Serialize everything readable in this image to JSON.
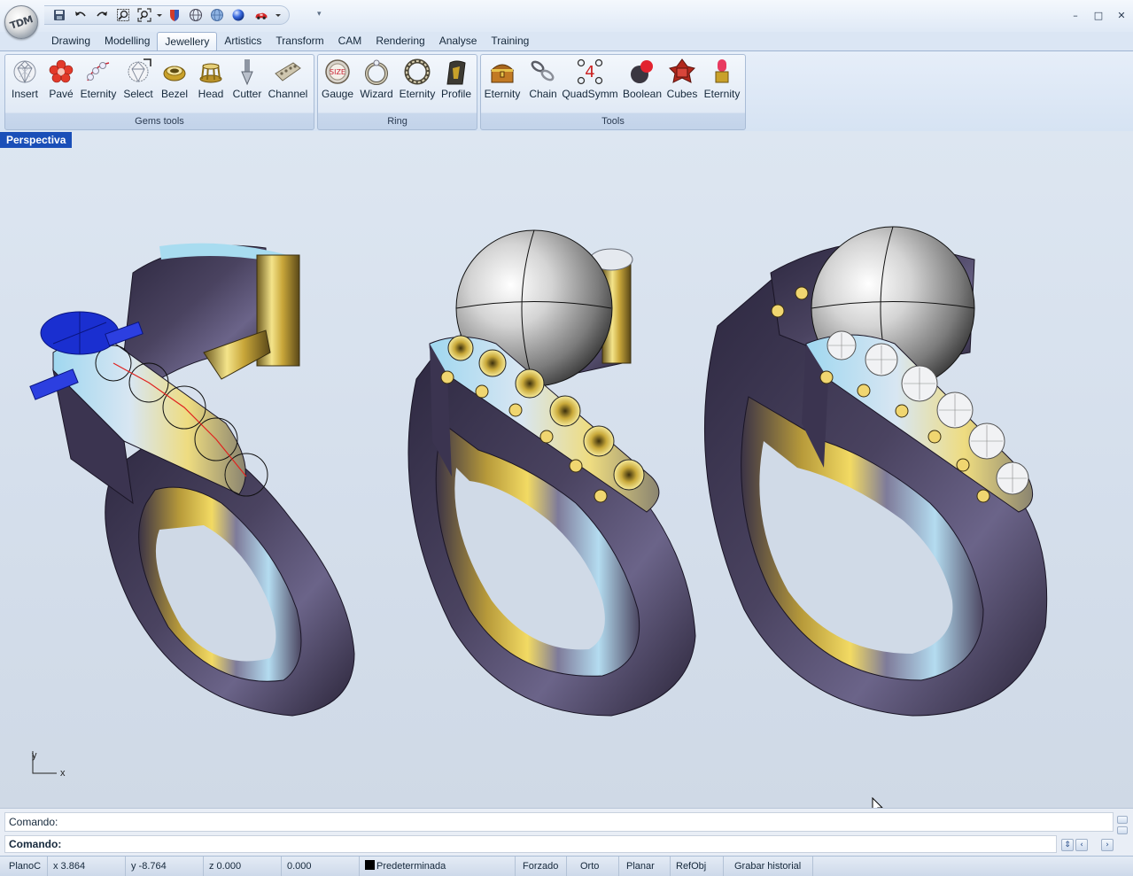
{
  "app": {
    "logo_text": "TDM"
  },
  "quick_access": {
    "icons": [
      "save-icon",
      "undo-icon",
      "redo-icon",
      "zoom-window-icon",
      "zoom-extents-icon",
      "shield-icon",
      "wireframe-sphere-icon",
      "shaded-sphere-icon",
      "rendered-sphere-icon",
      "car-render-icon"
    ]
  },
  "window_controls": {
    "minimize": "–",
    "maximize": "□",
    "close": "✕"
  },
  "tabs": [
    {
      "label": "Drawing"
    },
    {
      "label": "Modelling"
    },
    {
      "label": "Jewellery",
      "active": true
    },
    {
      "label": "Artistics"
    },
    {
      "label": "Transform"
    },
    {
      "label": "CAM"
    },
    {
      "label": "Rendering"
    },
    {
      "label": "Analyse"
    },
    {
      "label": "Training"
    }
  ],
  "ribbon": {
    "groups": [
      {
        "label": "Gems tools",
        "buttons": [
          {
            "label": "Insert",
            "icon": "diamond-icon"
          },
          {
            "label": "Pavé",
            "icon": "flower-gems-icon"
          },
          {
            "label": "Eternity",
            "icon": "gem-chain-icon"
          },
          {
            "label": "Select",
            "icon": "select-gem-icon"
          },
          {
            "label": "Bezel",
            "icon": "bezel-icon"
          },
          {
            "label": "Head",
            "icon": "head-icon"
          },
          {
            "label": "Cutter",
            "icon": "cutter-icon"
          },
          {
            "label": "Channel",
            "icon": "channel-icon"
          }
        ]
      },
      {
        "label": "Ring",
        "buttons": [
          {
            "label": "Gauge",
            "icon": "size-gauge-icon"
          },
          {
            "label": "Wizard",
            "icon": "ring-wizard-icon"
          },
          {
            "label": "Eternity",
            "icon": "eternity-ring-icon"
          },
          {
            "label": "Profile",
            "icon": "profile-icon"
          }
        ]
      },
      {
        "label": "Tools",
        "buttons": [
          {
            "label": "Eternity",
            "icon": "treasure-chest-icon"
          },
          {
            "label": "Chain",
            "icon": "chain-icon"
          },
          {
            "label": "QuadSymm",
            "icon": "quadsymm-icon",
            "glyph": "4"
          },
          {
            "label": "Boolean",
            "icon": "boolean-icon"
          },
          {
            "label": "Cubes",
            "icon": "cubes-icon"
          },
          {
            "label": "Eternity",
            "icon": "pin-eternity-icon"
          }
        ]
      }
    ]
  },
  "viewport": {
    "title": "Perspectiva",
    "axis_y": "y",
    "axis_x": "x"
  },
  "command": {
    "history": "Comando:",
    "prompt": "Comando:"
  },
  "statusbar": {
    "plane": "PlanoC",
    "x": "x 3.864",
    "y": "y -8.764",
    "z": "z 0.000",
    "value": "0.000",
    "layer": "Predeterminada",
    "forzado": "Forzado",
    "orto": "Orto",
    "planar": "Planar",
    "refobj": "RefObj",
    "history": "Grabar historial"
  },
  "colors": {
    "accent": "#1a4fb8",
    "metal_dark": "#3b3450",
    "gold": "#e6c94a",
    "gem_blue": "#1a2fd0"
  }
}
